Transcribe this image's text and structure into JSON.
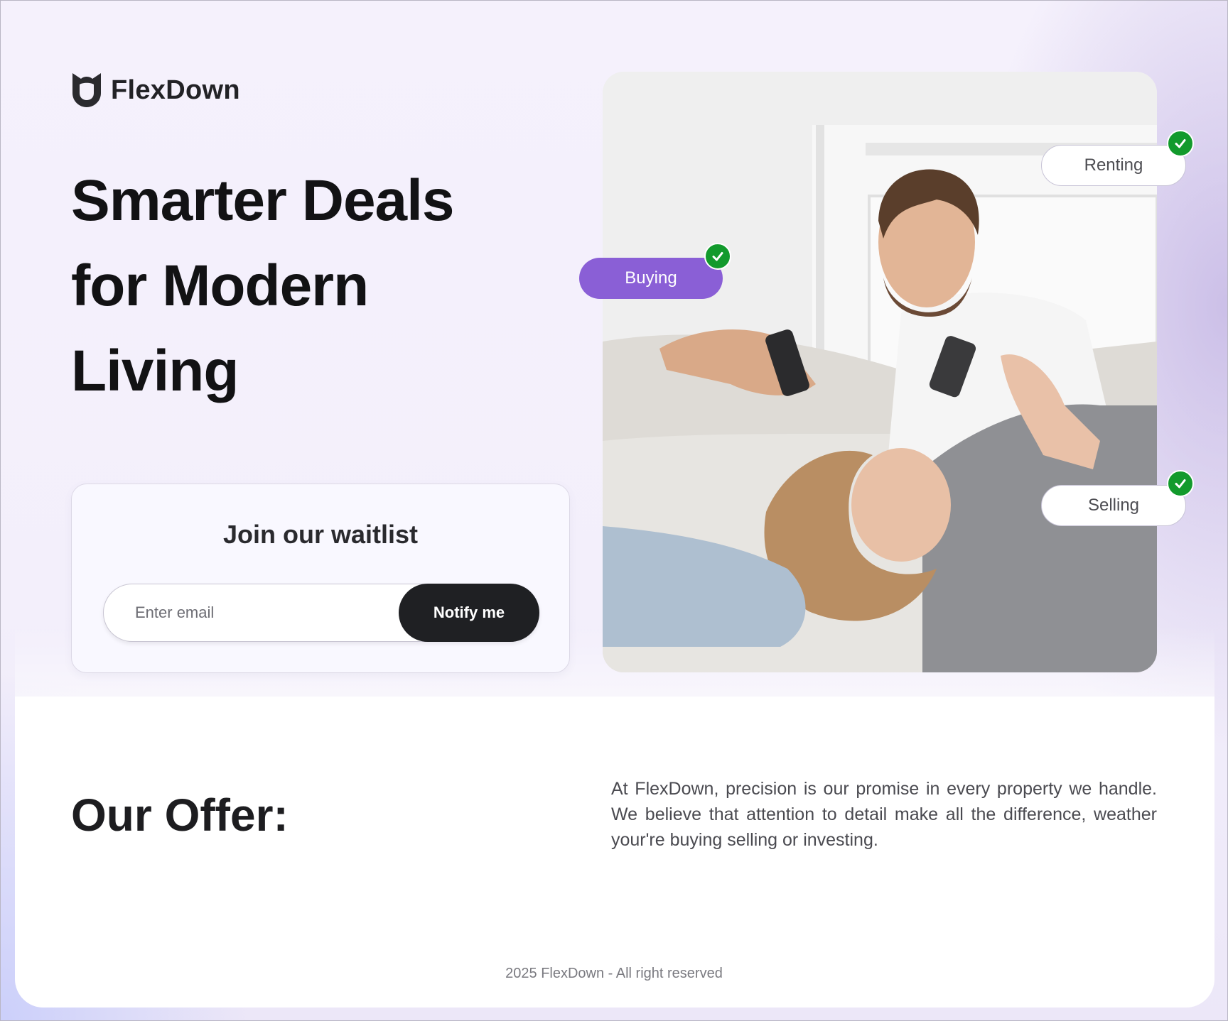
{
  "brand": {
    "name": "FlexDown",
    "logo_icon": "shield-logo-icon"
  },
  "hero": {
    "title": "Smarter Deals for Modern Living"
  },
  "waitlist": {
    "title": "Join our waitlist",
    "email_placeholder": "Enter email",
    "email_value": "",
    "button_label": "Notify me"
  },
  "tags": {
    "renting": "Renting",
    "buying": "Buying",
    "selling": "Selling",
    "check_icon": "check-icon"
  },
  "colors": {
    "accent_purple": "#8a5fd6",
    "check_green": "#129a2c",
    "button_dark": "#1f2023"
  },
  "offer": {
    "title": "Our Offer:",
    "text": "At FlexDown, precision is our promise in every property we handle. We believe that attention to detail make all the difference, weather your're buying selling or investing."
  },
  "footer": {
    "text": "2025 FlexDown -  All right reserved"
  }
}
